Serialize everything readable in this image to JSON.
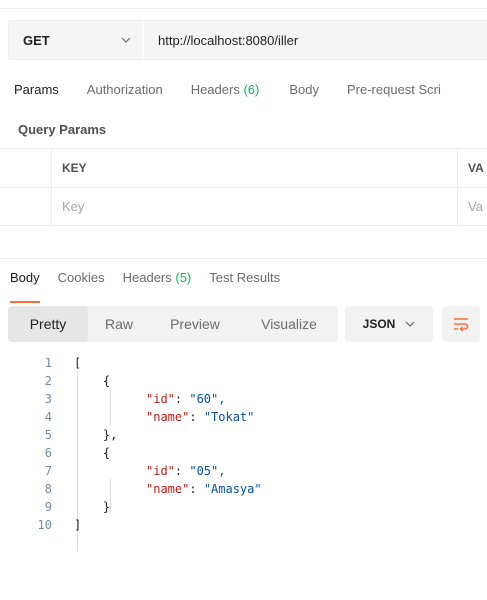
{
  "request": {
    "method": "GET",
    "url": "http://localhost:8080/iller"
  },
  "request_tabs": [
    {
      "label": "Params",
      "active": true
    },
    {
      "label": "Authorization"
    },
    {
      "label": "Headers",
      "count": "(6)"
    },
    {
      "label": "Body"
    },
    {
      "label": "Pre-request Scri"
    }
  ],
  "query_params": {
    "title": "Query Params",
    "header_key": "KEY",
    "header_value": "VA",
    "placeholder_key": "Key",
    "placeholder_value": "Va"
  },
  "response_tabs": [
    {
      "label": "Body",
      "active": true
    },
    {
      "label": "Cookies"
    },
    {
      "label": "Headers",
      "count": "(5)"
    },
    {
      "label": "Test Results"
    }
  ],
  "format_tabs": [
    "Pretty",
    "Raw",
    "Preview",
    "Visualize"
  ],
  "format_select": "JSON",
  "code_lines": [
    {
      "n": "1",
      "text": "["
    },
    {
      "n": "2",
      "text": "    {"
    },
    {
      "n": "3",
      "key": "\"id\"",
      "val": "\"60\","
    },
    {
      "n": "4",
      "key": "\"name\"",
      "val": "\"Tokat\""
    },
    {
      "n": "5",
      "text": "    },"
    },
    {
      "n": "6",
      "text": "    {"
    },
    {
      "n": "7",
      "key": "\"id\"",
      "val": "\"05\","
    },
    {
      "n": "8",
      "key": "\"name\"",
      "val": "\"Amasya\""
    },
    {
      "n": "9",
      "text": "    }"
    },
    {
      "n": "10",
      "text": "]"
    }
  ],
  "colors": {
    "accent": "#ff6c37",
    "count": "#0cbb52"
  }
}
